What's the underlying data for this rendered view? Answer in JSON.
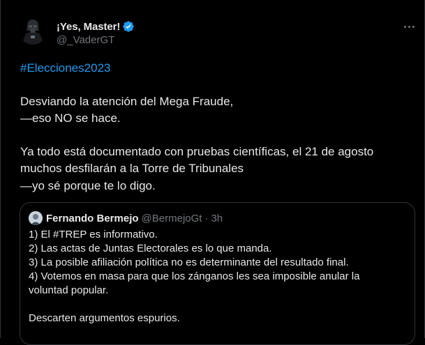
{
  "author": {
    "display_name": "¡Yes, Master!",
    "handle": "@_VaderGT",
    "verified": true
  },
  "menu": {
    "more_icon": "more-horizontal-icon"
  },
  "tweet": {
    "hashtag": "#Elecciones2023",
    "lines": [
      "Desviando la atención del Mega Fraude,",
      "—eso NO se hace.",
      "",
      "Ya todo está documentado con pruebas científicas, el 21 de agosto",
      "muchos desfilarán a la Torre de Tribunales",
      "—yo sé porque te lo digo."
    ]
  },
  "quote": {
    "display_name": "Fernando Bermejo",
    "handle": "@BermejoGt",
    "separator": "·",
    "time": "3h",
    "lines": [
      "1) El #TREP es informativo.",
      "2) Las actas de Juntas Electorales es lo que manda.",
      "3) La posible afiliación política no es determinante del resultado final.",
      "4) Votemos en masa para que los zánganos les sea imposible anular la",
      "voluntad popular.",
      "",
      "Descarten argumentos espurios."
    ]
  },
  "colors": {
    "background": "#000000",
    "text": "#e7e9ea",
    "secondary_text": "#71767b",
    "accent": "#1d9bf0",
    "border": "#2f3336"
  }
}
